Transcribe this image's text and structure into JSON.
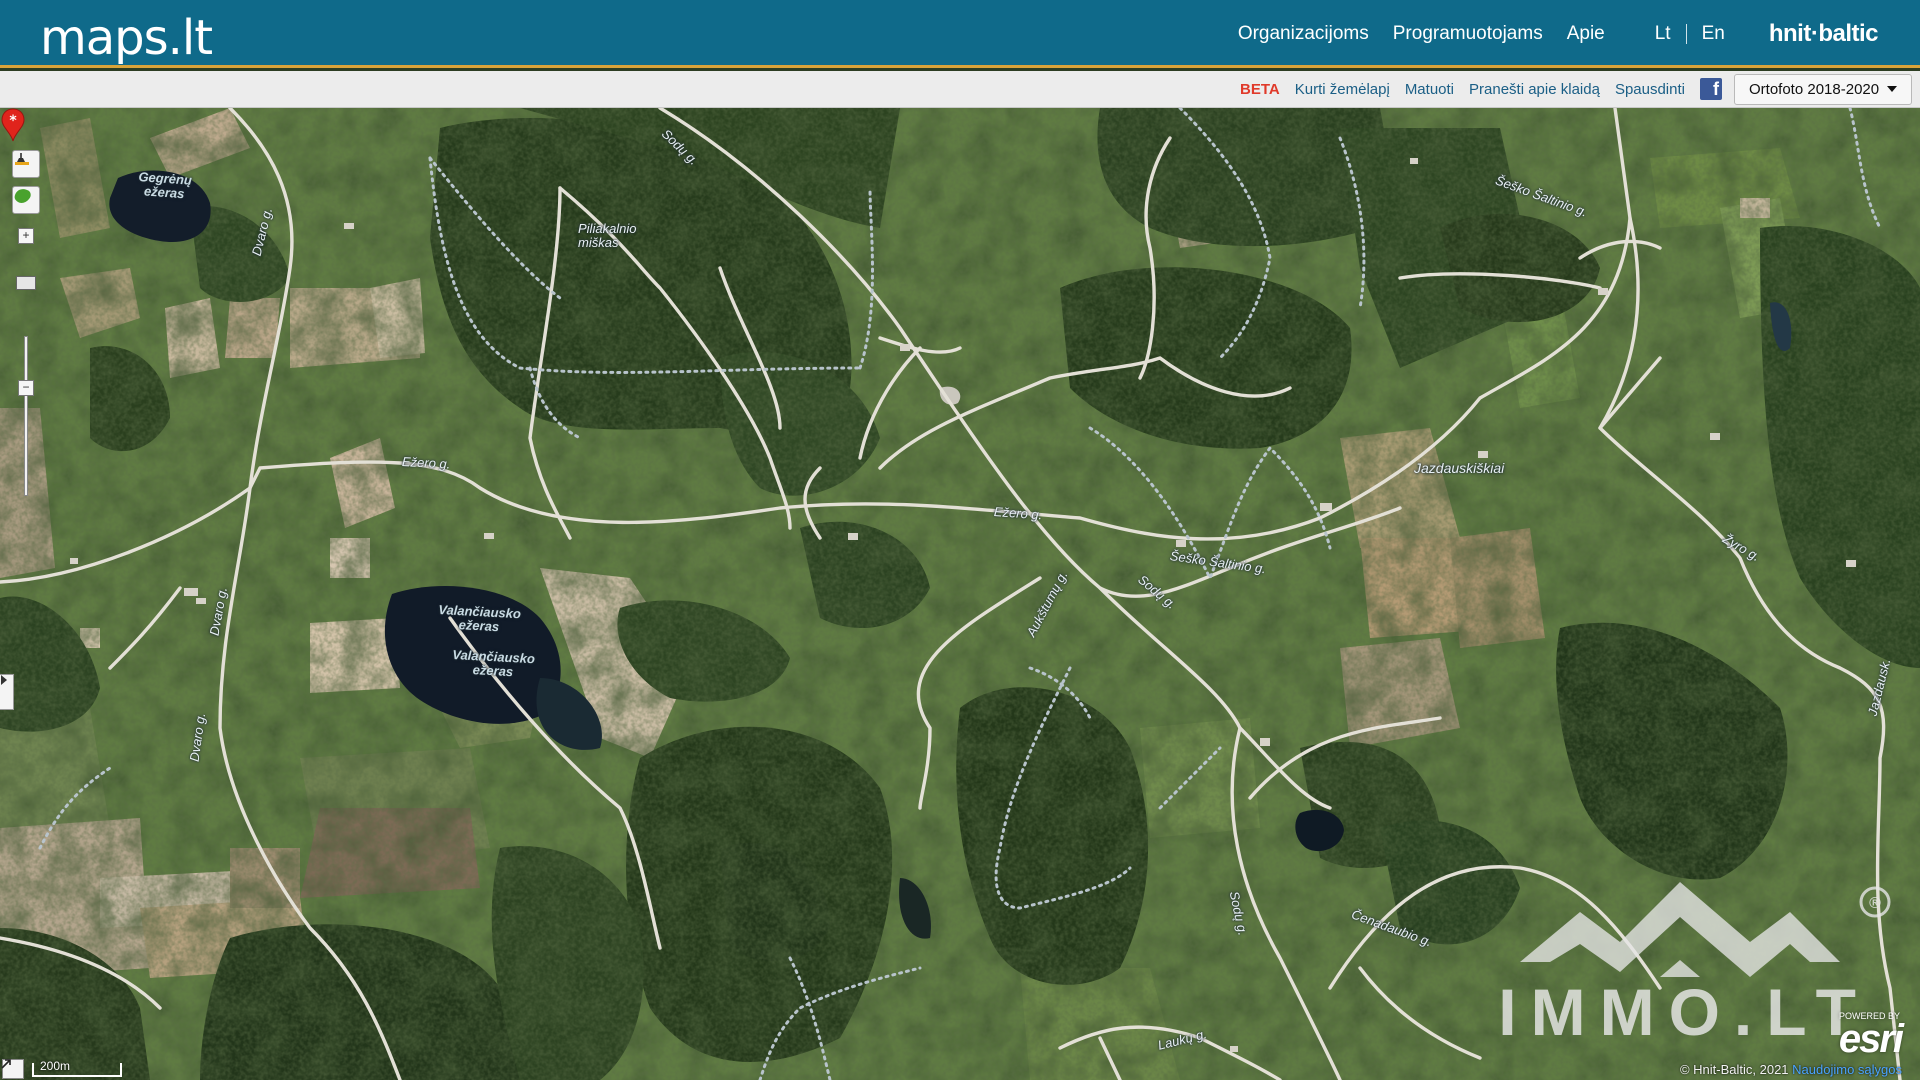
{
  "header": {
    "logo": "maps.lt",
    "nav": [
      "Organizacijoms",
      "Programuotojams",
      "Apie"
    ],
    "langs": [
      "Lt",
      "En"
    ],
    "brand": "hnit·baltic"
  },
  "toolbar": {
    "beta": "BETA",
    "create_map": "Kurti žemėlapį",
    "measure": "Matuoti",
    "report_error": "Pranešti apie klaidą",
    "print": "Spausdinti",
    "facebook_icon": "facebook-icon",
    "layer": "Ortofoto 2018-2020"
  },
  "map": {
    "labels": {
      "lake_gegrenu": "Gegrėnų\nežeras",
      "forest": "Piliakalnio\nmiškas",
      "lake_valanciausko_1": "Valančiausko\nežeras",
      "lake_valanciausko_2": "Valančiausko\nežeras",
      "village": "Jazdauskiškiai",
      "road_ezero_1": "Ežero g.",
      "road_ezero_2": "Ežero g.",
      "road_dvaro_1": "Dvaro g.",
      "road_dvaro_2": "Dvaro g.",
      "road_dvaro_3": "Dvaro g.",
      "road_sodu_1": "Sodų g.",
      "road_sodu_2": "Sodų g.",
      "road_sodu_3": "Sodų g.",
      "road_sesko_1": "Šeško Šaltinio g.",
      "road_sesko_2": "Šeško Šaltinio g.",
      "road_aukstumu": "Aukštumų g.",
      "road_zyro": "Žyro g.",
      "road_cenadaubio": "Čenadaubio g.",
      "road_lauku": "Laukų g.",
      "road_jazdausk": "Jazdausk."
    }
  },
  "scale": {
    "label": "200m"
  },
  "attribution": {
    "text": "© Hnit-Baltic, 2021",
    "link": "Naudojimo sąlygos"
  },
  "esri": {
    "powered": "POWERED BY",
    "name": "esri"
  },
  "watermark": {
    "text": "IMMO.LT",
    "reg": "®"
  }
}
